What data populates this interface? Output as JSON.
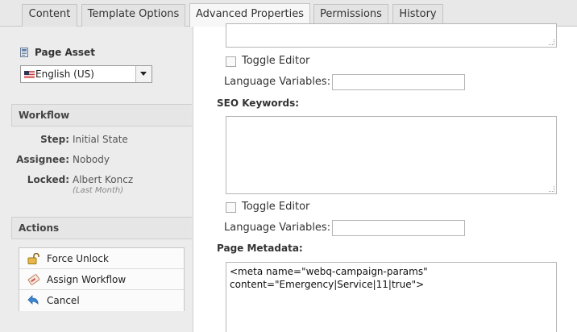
{
  "tabs": [
    {
      "label": "Content"
    },
    {
      "label": "Template Options"
    },
    {
      "label": "Advanced Properties",
      "active": true
    },
    {
      "label": "Permissions"
    },
    {
      "label": "History"
    }
  ],
  "sidebar": {
    "asset_title": "Page Asset",
    "language_select": {
      "value": "English (US)"
    },
    "workflow": {
      "heading": "Workflow",
      "step_label": "Step:",
      "step_value": "Initial State",
      "assignee_label": "Assignee:",
      "assignee_value": "Nobody",
      "locked_label": "Locked:",
      "locked_value": "Albert Koncz",
      "locked_when": "(Last Month)"
    },
    "actions": {
      "heading": "Actions",
      "items": [
        {
          "label": "Force Unlock",
          "icon": "unlock-icon"
        },
        {
          "label": "Assign Workflow",
          "icon": "assign-workflow-icon"
        },
        {
          "label": "Cancel",
          "icon": "cancel-back-icon"
        }
      ]
    }
  },
  "main": {
    "first_block": {
      "toggle_label": "Toggle Editor",
      "lang_vars_label": "Language Variables:",
      "lang_vars_value": ""
    },
    "seo": {
      "label": "SEO Keywords:",
      "value": "",
      "toggle_label": "Toggle Editor",
      "lang_vars_label": "Language Variables:",
      "lang_vars_value": ""
    },
    "metadata": {
      "label": "Page Metadata:",
      "value": "<meta name=\"webq-campaign-params\"\ncontent=\"Emergency|Service|11|true\">"
    }
  },
  "colors": {
    "tab_bg": "#e4e4e4",
    "tab_active_bg": "#f7f7f7",
    "sidebar_bg": "#ececec",
    "border": "#b5b5b5"
  }
}
